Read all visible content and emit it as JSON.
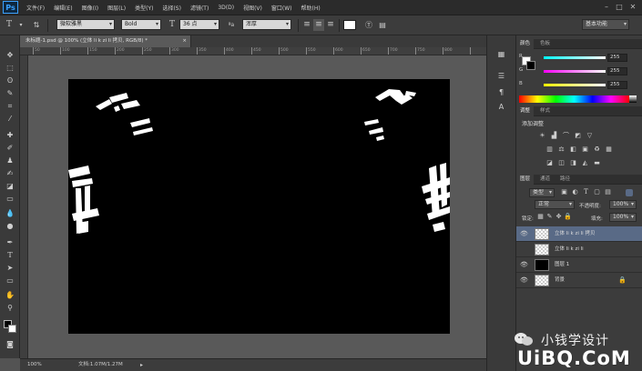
{
  "app": {
    "logo": "Ps"
  },
  "menubar": {
    "items": [
      "文件(F)",
      "编辑(E)",
      "图像(I)",
      "图层(L)",
      "类型(Y)",
      "选择(S)",
      "滤镜(T)",
      "3D(D)",
      "视图(V)",
      "窗口(W)",
      "帮助(H)"
    ]
  },
  "options": {
    "font_family": "微软雅黑",
    "font_style": "Bold",
    "font_size": "36 点",
    "antialias": "浑厚",
    "workspace": "基本功能",
    "text_color": "#ffffff"
  },
  "document": {
    "tab_title": "未标题-1.psd @ 100% (立体 li  k  zi  li 拷贝, RGB/8) *",
    "ruler_labels": [
      "50",
      "100",
      "150",
      "200",
      "250",
      "300",
      "350",
      "400",
      "450",
      "500",
      "550",
      "600",
      "650",
      "700",
      "750",
      "800"
    ],
    "zoom": "100%",
    "doc_size": "文档:1.07M/1.27M"
  },
  "color_panel": {
    "tabs": [
      "颜色",
      "色板"
    ],
    "channels": [
      {
        "label": "R",
        "value": "255"
      },
      {
        "label": "G",
        "value": "255"
      },
      {
        "label": "B",
        "value": "255"
      }
    ]
  },
  "adjust_panel": {
    "tabs": [
      "调整",
      "样式"
    ],
    "title": "添加调整"
  },
  "layers_panel": {
    "tabs": [
      "图层",
      "通道",
      "路径"
    ],
    "filter_kind": "类型",
    "blend_mode": "正常",
    "opacity_label": "不透明度:",
    "opacity": "100%",
    "lock_label": "锁定:",
    "fill_label": "填充:",
    "fill": "100%",
    "layers": [
      {
        "name": "立体 li  k  zi  li 拷贝",
        "thumb": "check",
        "visible": true,
        "selected": true
      },
      {
        "name": "立体 li  k  zi  li",
        "thumb": "check",
        "visible": false,
        "selected": false
      },
      {
        "name": "图层 1",
        "thumb": "black",
        "visible": true,
        "selected": false
      },
      {
        "name": "背景",
        "thumb": "check",
        "visible": true,
        "selected": false,
        "locked": true
      }
    ]
  },
  "watermark": {
    "line1": "小钱学设计",
    "line2": "UiBQ.CoM"
  }
}
